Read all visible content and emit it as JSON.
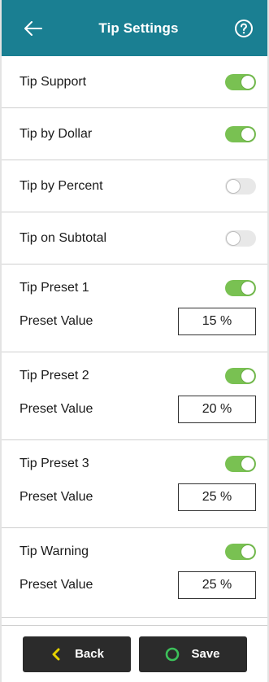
{
  "header": {
    "title": "Tip Settings"
  },
  "settings": [
    {
      "label": "Tip Support",
      "enabled": true
    },
    {
      "label": "Tip by Dollar",
      "enabled": true
    },
    {
      "label": "Tip by Percent",
      "enabled": false
    },
    {
      "label": "Tip on Subtotal",
      "enabled": false
    }
  ],
  "presets": [
    {
      "label": "Tip Preset 1",
      "enabled": true,
      "value_label": "Preset Value",
      "value": "15 %"
    },
    {
      "label": "Tip Preset 2",
      "enabled": true,
      "value_label": "Preset Value",
      "value": "20 %"
    },
    {
      "label": "Tip Preset 3",
      "enabled": true,
      "value_label": "Preset Value",
      "value": "25 %"
    },
    {
      "label": "Tip Warning",
      "enabled": true,
      "value_label": "Preset Value",
      "value": "25 %"
    }
  ],
  "footer": {
    "back_label": "Back",
    "save_label": "Save"
  },
  "colors": {
    "header_bg": "#1a7f92",
    "toggle_on": "#79c152",
    "toggle_off": "#e8e8e8",
    "button_bg": "#2b2b2b",
    "back_icon": "#e6d200",
    "save_icon": "#3cc05a"
  },
  "icons": {
    "back": "arrow-left-icon",
    "help": "question-circle-icon",
    "back_button": "chevron-left-icon",
    "save_button": "circle-icon"
  }
}
